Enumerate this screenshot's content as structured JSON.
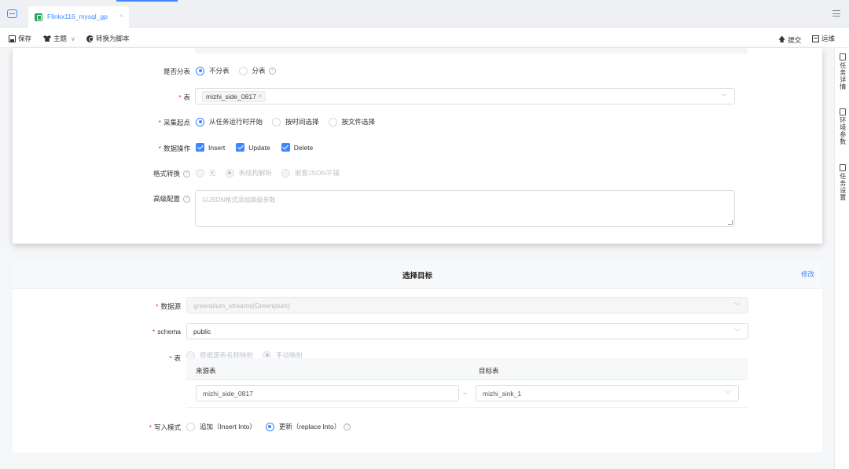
{
  "tabbar": {
    "tab_title": "Flinkx116_mysql_gp",
    "close": "×"
  },
  "toolbar": {
    "save": "保存",
    "theme": "主题",
    "theme_caret": "∨",
    "convert": "转换为脚本",
    "submit": "提交",
    "ops": "运维"
  },
  "source": {
    "split_table": {
      "label": "是否分表",
      "options": [
        "不分表",
        "分表"
      ],
      "selected": "不分表"
    },
    "table": {
      "label": "表",
      "tag": "mizhi_side_0817",
      "tag_close": "×"
    },
    "start_point": {
      "label": "采集起点",
      "options": [
        "从任务运行时开始",
        "按时间选择",
        "按文件选择"
      ],
      "selected": "从任务运行时开始"
    },
    "data_op": {
      "label": "数据操作",
      "options": [
        "Insert",
        "Update",
        "Delete"
      ]
    },
    "format": {
      "label": "格式转换",
      "options": [
        "无",
        "表结构解析",
        "嵌套JSON平铺"
      ],
      "selected": "表结构解析"
    },
    "advanced": {
      "label": "高级配置",
      "placeholder": "以JSON格式添加高级参数"
    }
  },
  "target": {
    "title": "选择目标",
    "edit": "修改",
    "datasource": {
      "label": "数据源",
      "value": "greenplum_streams(Greenplum)"
    },
    "schema": {
      "label": "schema",
      "value": "public"
    },
    "table": {
      "label": "表",
      "options": [
        "根据源表名称映射",
        "手动映射"
      ],
      "selected": "手动映射",
      "col_source": "来源表",
      "col_target": "目标表",
      "source_value": "mizhi_side_0817",
      "separator": "--",
      "target_value": "mizhi_sink_1"
    },
    "write_mode": {
      "label": "写入模式",
      "options": [
        "追加（Insert Into）",
        "更新（replace Into）"
      ],
      "selected": "更新（replace Into）"
    }
  },
  "side_panel": {
    "items": [
      "任务详情",
      "环境参数",
      "任务设置"
    ]
  },
  "colors": {
    "accent": "#3f87ff",
    "required": "#f5222d"
  }
}
